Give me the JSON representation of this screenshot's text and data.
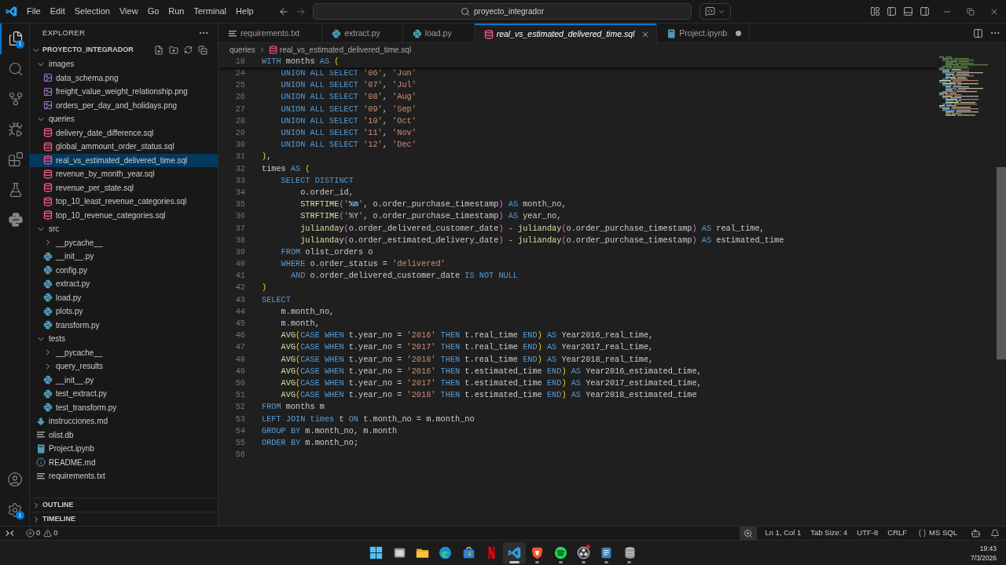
{
  "title_bar": {
    "menu": [
      "File",
      "Edit",
      "Selection",
      "View",
      "Go",
      "Run",
      "Terminal",
      "Help"
    ],
    "search": {
      "value": "proyecto_integrador"
    }
  },
  "activity_bar": {
    "items": [
      {
        "kind": "explorer",
        "selected": true,
        "badge": "1"
      },
      {
        "kind": "search",
        "selected": false
      },
      {
        "kind": "source_control",
        "selected": false
      },
      {
        "kind": "run_debug",
        "selected": false
      },
      {
        "kind": "extensions",
        "selected": false
      },
      {
        "kind": "testing",
        "selected": false
      },
      {
        "kind": "python",
        "selected": false
      }
    ],
    "bottom": [
      {
        "kind": "account"
      },
      {
        "kind": "settings",
        "badge": "1"
      }
    ]
  },
  "sidebar": {
    "title": "EXPLORER",
    "root": {
      "label": "PROYECTO_INTEGRADOR",
      "expanded": true
    },
    "tree": [
      {
        "label": "images",
        "kind": "folder",
        "expanded": true,
        "selected": false,
        "children": [
          {
            "label": "data_schema.png",
            "kind": "image",
            "selected": false
          },
          {
            "label": "freight_value_weight_relationship.png",
            "kind": "image",
            "selected": false
          },
          {
            "label": "orders_per_day_and_holidays.png",
            "kind": "image",
            "selected": false
          }
        ]
      },
      {
        "label": "queries",
        "kind": "folder",
        "expanded": true,
        "selected": false,
        "children": [
          {
            "label": "delivery_date_difference.sql",
            "kind": "sql",
            "selected": false
          },
          {
            "label": "global_ammount_order_status.sql",
            "kind": "sql",
            "selected": false
          },
          {
            "label": "real_vs_estimated_delivered_time.sql",
            "kind": "sql",
            "selected": true
          },
          {
            "label": "revenue_by_month_year.sql",
            "kind": "sql",
            "selected": false
          },
          {
            "label": "revenue_per_state.sql",
            "kind": "sql",
            "selected": false
          },
          {
            "label": "top_10_least_revenue_categories.sql",
            "kind": "sql",
            "selected": false
          },
          {
            "label": "top_10_revenue_categories.sql",
            "kind": "sql",
            "selected": false
          }
        ]
      },
      {
        "label": "src",
        "kind": "folder",
        "expanded": true,
        "selected": false,
        "children": [
          {
            "label": "__pycache__",
            "kind": "folder",
            "expanded": false,
            "selected": false
          },
          {
            "label": "__init__.py",
            "kind": "python",
            "selected": false
          },
          {
            "label": "config.py",
            "kind": "python",
            "selected": false
          },
          {
            "label": "extract.py",
            "kind": "python",
            "selected": false
          },
          {
            "label": "load.py",
            "kind": "python",
            "selected": false
          },
          {
            "label": "plots.py",
            "kind": "python",
            "selected": false
          },
          {
            "label": "transform.py",
            "kind": "python",
            "selected": false
          }
        ]
      },
      {
        "label": "tests",
        "kind": "folder",
        "expanded": true,
        "selected": false,
        "children": [
          {
            "label": "__pycache__",
            "kind": "folder",
            "expanded": false,
            "selected": false
          },
          {
            "label": "query_results",
            "kind": "folder",
            "expanded": false,
            "selected": false
          },
          {
            "label": "__init__.py",
            "kind": "python",
            "selected": false
          },
          {
            "label": "test_extract.py",
            "kind": "python",
            "selected": false
          },
          {
            "label": "test_transform.py",
            "kind": "python",
            "selected": false
          }
        ]
      },
      {
        "label": "instrucciones.md",
        "kind": "markdown",
        "selected": false
      },
      {
        "label": "olist.db",
        "kind": "text",
        "selected": false
      },
      {
        "label": "Project.ipynb",
        "kind": "notebook",
        "selected": false
      },
      {
        "label": "README.md",
        "kind": "info",
        "selected": false
      },
      {
        "label": "requirements.txt",
        "kind": "text",
        "selected": false
      }
    ],
    "sections": [
      {
        "label": "OUTLINE",
        "expanded": false
      },
      {
        "label": "TIMELINE",
        "expanded": false
      }
    ]
  },
  "tabs": [
    {
      "label": "requirements.txt",
      "kind": "text",
      "selected": false,
      "preview": false,
      "modified": false
    },
    {
      "label": "extract.py",
      "kind": "python",
      "selected": false,
      "preview": false,
      "modified": false
    },
    {
      "label": "load.py",
      "kind": "python",
      "selected": false,
      "preview": false,
      "modified": false
    },
    {
      "label": "real_vs_estimated_delivered_time.sql",
      "kind": "sql",
      "selected": true,
      "preview": true,
      "modified": false
    },
    {
      "label": "Project.ipynb",
      "kind": "notebook",
      "selected": false,
      "preview": false,
      "modified": true
    }
  ],
  "breadcrumb": [
    {
      "label": "queries",
      "kind": "folder"
    },
    {
      "label": "real_vs_estimated_delivered_time.sql",
      "kind": "sql"
    }
  ],
  "editor": {
    "sticky": {
      "number": "18",
      "tokens": [
        {
          "kind": "keyword",
          "text": "WITH"
        },
        {
          "kind": "plain",
          "text": " months "
        },
        {
          "kind": "keyword",
          "text": "AS "
        },
        {
          "kind": "bracket1",
          "text": "("
        }
      ]
    },
    "lines": [
      {
        "number": "24",
        "tokens": [
          {
            "kind": "keyword",
            "text": "    UNION ALL SELECT "
          },
          {
            "kind": "string",
            "text": "'06'"
          },
          {
            "kind": "plain",
            "text": ", "
          },
          {
            "kind": "string",
            "text": "'Jun'"
          }
        ]
      },
      {
        "number": "25",
        "tokens": [
          {
            "kind": "keyword",
            "text": "    UNION ALL SELECT "
          },
          {
            "kind": "string",
            "text": "'07'"
          },
          {
            "kind": "plain",
            "text": ", "
          },
          {
            "kind": "string",
            "text": "'Jul'"
          }
        ]
      },
      {
        "number": "26",
        "tokens": [
          {
            "kind": "keyword",
            "text": "    UNION ALL SELECT "
          },
          {
            "kind": "string",
            "text": "'08'"
          },
          {
            "kind": "plain",
            "text": ", "
          },
          {
            "kind": "string",
            "text": "'Aug'"
          }
        ]
      },
      {
        "number": "27",
        "tokens": [
          {
            "kind": "keyword",
            "text": "    UNION ALL SELECT "
          },
          {
            "kind": "string",
            "text": "'09'"
          },
          {
            "kind": "plain",
            "text": ", "
          },
          {
            "kind": "string",
            "text": "'Sep'"
          }
        ]
      },
      {
        "number": "28",
        "tokens": [
          {
            "kind": "keyword",
            "text": "    UNION ALL SELECT "
          },
          {
            "kind": "string",
            "text": "'10'"
          },
          {
            "kind": "plain",
            "text": ", "
          },
          {
            "kind": "string",
            "text": "'Oct'"
          }
        ]
      },
      {
        "number": "29",
        "tokens": [
          {
            "kind": "keyword",
            "text": "    UNION ALL SELECT "
          },
          {
            "kind": "string",
            "text": "'11'"
          },
          {
            "kind": "plain",
            "text": ", "
          },
          {
            "kind": "string",
            "text": "'Nov'"
          }
        ]
      },
      {
        "number": "30",
        "tokens": [
          {
            "kind": "keyword",
            "text": "    UNION ALL SELECT "
          },
          {
            "kind": "string",
            "text": "'12'"
          },
          {
            "kind": "plain",
            "text": ", "
          },
          {
            "kind": "string",
            "text": "'Dec'"
          }
        ]
      },
      {
        "number": "31",
        "tokens": [
          {
            "kind": "bracket1",
            "text": ")"
          },
          {
            "kind": "plain",
            "text": ","
          }
        ]
      },
      {
        "number": "32",
        "tokens": [
          {
            "kind": "plain",
            "text": "times "
          },
          {
            "kind": "keyword",
            "text": "AS "
          },
          {
            "kind": "bracket1",
            "text": "("
          }
        ]
      },
      {
        "number": "33",
        "tokens": [
          {
            "kind": "keyword",
            "text": "    SELECT DISTINCT"
          }
        ]
      },
      {
        "number": "34",
        "tokens": [
          {
            "kind": "plain",
            "text": "        o.order_id,"
          }
        ]
      },
      {
        "number": "35",
        "tokens": [
          {
            "kind": "function",
            "text": "        STRFTIME"
          },
          {
            "kind": "bracket2",
            "text": "("
          },
          {
            "kind": "string",
            "text": "'"
          },
          {
            "kind": "escape",
            "text": "%m"
          },
          {
            "kind": "string",
            "text": "'"
          },
          {
            "kind": "plain",
            "text": ", o.order_purchase_timestamp"
          },
          {
            "kind": "bracket2",
            "text": ")"
          },
          {
            "kind": "keyword",
            "text": " AS"
          },
          {
            "kind": "plain",
            "text": " month_no,"
          }
        ]
      },
      {
        "number": "36",
        "tokens": [
          {
            "kind": "function",
            "text": "        STRFTIME"
          },
          {
            "kind": "bracket2",
            "text": "("
          },
          {
            "kind": "string",
            "text": "'"
          },
          {
            "kind": "escape",
            "text": "%Y"
          },
          {
            "kind": "string",
            "text": "'"
          },
          {
            "kind": "plain",
            "text": ", o.order_purchase_timestamp"
          },
          {
            "kind": "bracket2",
            "text": ")"
          },
          {
            "kind": "keyword",
            "text": " AS"
          },
          {
            "kind": "plain",
            "text": " year_no,"
          }
        ]
      },
      {
        "number": "37",
        "tokens": [
          {
            "kind": "function",
            "text": "        julianday"
          },
          {
            "kind": "bracket2",
            "text": "("
          },
          {
            "kind": "plain",
            "text": "o.order_delivered_customer_date"
          },
          {
            "kind": "bracket2",
            "text": ")"
          },
          {
            "kind": "plain",
            "text": " - "
          },
          {
            "kind": "function",
            "text": "julianday"
          },
          {
            "kind": "bracket2",
            "text": "("
          },
          {
            "kind": "plain",
            "text": "o.order_purchase_timestamp"
          },
          {
            "kind": "bracket2",
            "text": ")"
          },
          {
            "kind": "keyword",
            "text": " AS"
          },
          {
            "kind": "plain",
            "text": " real_time,"
          }
        ]
      },
      {
        "number": "38",
        "tokens": [
          {
            "kind": "function",
            "text": "        julianday"
          },
          {
            "kind": "bracket2",
            "text": "("
          },
          {
            "kind": "plain",
            "text": "o.order_estimated_delivery_date"
          },
          {
            "kind": "bracket2",
            "text": ")"
          },
          {
            "kind": "plain",
            "text": " - "
          },
          {
            "kind": "function",
            "text": "julianday"
          },
          {
            "kind": "bracket2",
            "text": "("
          },
          {
            "kind": "plain",
            "text": "o.order_purchase_timestamp"
          },
          {
            "kind": "bracket2",
            "text": ")"
          },
          {
            "kind": "keyword",
            "text": " AS"
          },
          {
            "kind": "plain",
            "text": " estimated_time"
          }
        ]
      },
      {
        "number": "39",
        "tokens": [
          {
            "kind": "keyword",
            "text": "    FROM"
          },
          {
            "kind": "plain",
            "text": " olist_orders o"
          }
        ]
      },
      {
        "number": "40",
        "tokens": [
          {
            "kind": "keyword",
            "text": "    WHERE"
          },
          {
            "kind": "plain",
            "text": " o.order_status = "
          },
          {
            "kind": "string",
            "text": "'delivered'"
          }
        ]
      },
      {
        "number": "41",
        "tokens": [
          {
            "kind": "keyword",
            "text": "      AND"
          },
          {
            "kind": "plain",
            "text": " o.order_delivered_customer_date "
          },
          {
            "kind": "keyword",
            "text": "IS NOT NULL"
          }
        ]
      },
      {
        "number": "42",
        "tokens": [
          {
            "kind": "bracket1",
            "text": ")"
          }
        ]
      },
      {
        "number": "43",
        "tokens": [
          {
            "kind": "keyword",
            "text": "SELECT"
          }
        ]
      },
      {
        "number": "44",
        "tokens": [
          {
            "kind": "plain",
            "text": "    m.month_no,"
          }
        ]
      },
      {
        "number": "45",
        "tokens": [
          {
            "kind": "plain",
            "text": "    m.month,"
          }
        ]
      },
      {
        "number": "46",
        "tokens": [
          {
            "kind": "function",
            "text": "    AVG"
          },
          {
            "kind": "bracket1",
            "text": "("
          },
          {
            "kind": "keyword",
            "text": "CASE WHEN"
          },
          {
            "kind": "plain",
            "text": " t.year_no = "
          },
          {
            "kind": "string",
            "text": "'2016'"
          },
          {
            "kind": "keyword",
            "text": " THEN"
          },
          {
            "kind": "plain",
            "text": " t.real_time "
          },
          {
            "kind": "keyword",
            "text": "END"
          },
          {
            "kind": "bracket1",
            "text": ")"
          },
          {
            "kind": "keyword",
            "text": " AS"
          },
          {
            "kind": "plain",
            "text": " Year2016_real_time,"
          }
        ]
      },
      {
        "number": "47",
        "tokens": [
          {
            "kind": "function",
            "text": "    AVG"
          },
          {
            "kind": "bracket1",
            "text": "("
          },
          {
            "kind": "keyword",
            "text": "CASE WHEN"
          },
          {
            "kind": "plain",
            "text": " t.year_no = "
          },
          {
            "kind": "string",
            "text": "'2017'"
          },
          {
            "kind": "keyword",
            "text": " THEN"
          },
          {
            "kind": "plain",
            "text": " t.real_time "
          },
          {
            "kind": "keyword",
            "text": "END"
          },
          {
            "kind": "bracket1",
            "text": ")"
          },
          {
            "kind": "keyword",
            "text": " AS"
          },
          {
            "kind": "plain",
            "text": " Year2017_real_time,"
          }
        ]
      },
      {
        "number": "48",
        "tokens": [
          {
            "kind": "function",
            "text": "    AVG"
          },
          {
            "kind": "bracket1",
            "text": "("
          },
          {
            "kind": "keyword",
            "text": "CASE WHEN"
          },
          {
            "kind": "plain",
            "text": " t.year_no = "
          },
          {
            "kind": "string",
            "text": "'2018'"
          },
          {
            "kind": "keyword",
            "text": " THEN"
          },
          {
            "kind": "plain",
            "text": " t.real_time "
          },
          {
            "kind": "keyword",
            "text": "END"
          },
          {
            "kind": "bracket1",
            "text": ")"
          },
          {
            "kind": "keyword",
            "text": " AS"
          },
          {
            "kind": "plain",
            "text": " Year2018_real_time,"
          }
        ]
      },
      {
        "number": "49",
        "tokens": [
          {
            "kind": "function",
            "text": "    AVG"
          },
          {
            "kind": "bracket1",
            "text": "("
          },
          {
            "kind": "keyword",
            "text": "CASE WHEN"
          },
          {
            "kind": "plain",
            "text": " t.year_no = "
          },
          {
            "kind": "string",
            "text": "'2016'"
          },
          {
            "kind": "keyword",
            "text": " THEN"
          },
          {
            "kind": "plain",
            "text": " t.estimated_time "
          },
          {
            "kind": "keyword",
            "text": "END"
          },
          {
            "kind": "bracket1",
            "text": ")"
          },
          {
            "kind": "keyword",
            "text": " AS"
          },
          {
            "kind": "plain",
            "text": " Year2016_estimated_time,"
          }
        ]
      },
      {
        "number": "50",
        "tokens": [
          {
            "kind": "function",
            "text": "    AVG"
          },
          {
            "kind": "bracket1",
            "text": "("
          },
          {
            "kind": "keyword",
            "text": "CASE WHEN"
          },
          {
            "kind": "plain",
            "text": " t.year_no = "
          },
          {
            "kind": "string",
            "text": "'2017'"
          },
          {
            "kind": "keyword",
            "text": " THEN"
          },
          {
            "kind": "plain",
            "text": " t.estimated_time "
          },
          {
            "kind": "keyword",
            "text": "END"
          },
          {
            "kind": "bracket1",
            "text": ")"
          },
          {
            "kind": "keyword",
            "text": " AS"
          },
          {
            "kind": "plain",
            "text": " Year2017_estimated_time,"
          }
        ]
      },
      {
        "number": "51",
        "tokens": [
          {
            "kind": "function",
            "text": "    AVG"
          },
          {
            "kind": "bracket1",
            "text": "("
          },
          {
            "kind": "keyword",
            "text": "CASE WHEN"
          },
          {
            "kind": "plain",
            "text": " t.year_no = "
          },
          {
            "kind": "string",
            "text": "'2018'"
          },
          {
            "kind": "keyword",
            "text": " THEN"
          },
          {
            "kind": "plain",
            "text": " t.estimated_time "
          },
          {
            "kind": "keyword",
            "text": "END"
          },
          {
            "kind": "bracket1",
            "text": ")"
          },
          {
            "kind": "keyword",
            "text": " AS"
          },
          {
            "kind": "plain",
            "text": " Year2018_estimated_time"
          }
        ]
      },
      {
        "number": "52",
        "tokens": [
          {
            "kind": "keyword",
            "text": "FROM"
          },
          {
            "kind": "plain",
            "text": " months m"
          }
        ]
      },
      {
        "number": "53",
        "tokens": [
          {
            "kind": "keyword",
            "text": "LEFT JOIN times"
          },
          {
            "kind": "plain",
            "text": " t "
          },
          {
            "kind": "keyword",
            "text": "ON"
          },
          {
            "kind": "plain",
            "text": " t.month_no = m.month_no"
          }
        ]
      },
      {
        "number": "54",
        "tokens": [
          {
            "kind": "keyword",
            "text": "GROUP BY"
          },
          {
            "kind": "plain",
            "text": " m.month_no, m.month"
          }
        ]
      },
      {
        "number": "55",
        "tokens": [
          {
            "kind": "keyword",
            "text": "ORDER BY"
          },
          {
            "kind": "plain",
            "text": " m.month_no;"
          }
        ]
      },
      {
        "number": "56"
      }
    ]
  },
  "status_bar": {
    "problems": {
      "errors": "0",
      "warnings": "0"
    },
    "items": [
      "Ln 1, Col 1",
      "Tab Size: 4",
      "UTF-8",
      "CRLF"
    ],
    "language": "MS SQL"
  },
  "taskbar": {
    "apps": [
      {
        "kind": "start",
        "selected": false,
        "running": false
      },
      {
        "kind": "window",
        "selected": false,
        "running": false
      },
      {
        "kind": "folder",
        "selected": false,
        "running": false
      },
      {
        "kind": "swirl",
        "selected": false,
        "running": false
      },
      {
        "kind": "bag",
        "selected": false,
        "running": false
      },
      {
        "kind": "stripes",
        "selected": false,
        "running": false
      },
      {
        "kind": "code",
        "selected": true,
        "running": true
      },
      {
        "kind": "shield",
        "selected": false,
        "running": true
      },
      {
        "kind": "waves",
        "selected": false,
        "running": true
      },
      {
        "kind": "aperture",
        "selected": false,
        "running": true,
        "notification": true
      },
      {
        "kind": "notepad",
        "selected": false,
        "running": true
      },
      {
        "kind": "cylinders",
        "selected": false,
        "running": true
      }
    ],
    "time": "19:43",
    "date": "7/3/2026"
  }
}
